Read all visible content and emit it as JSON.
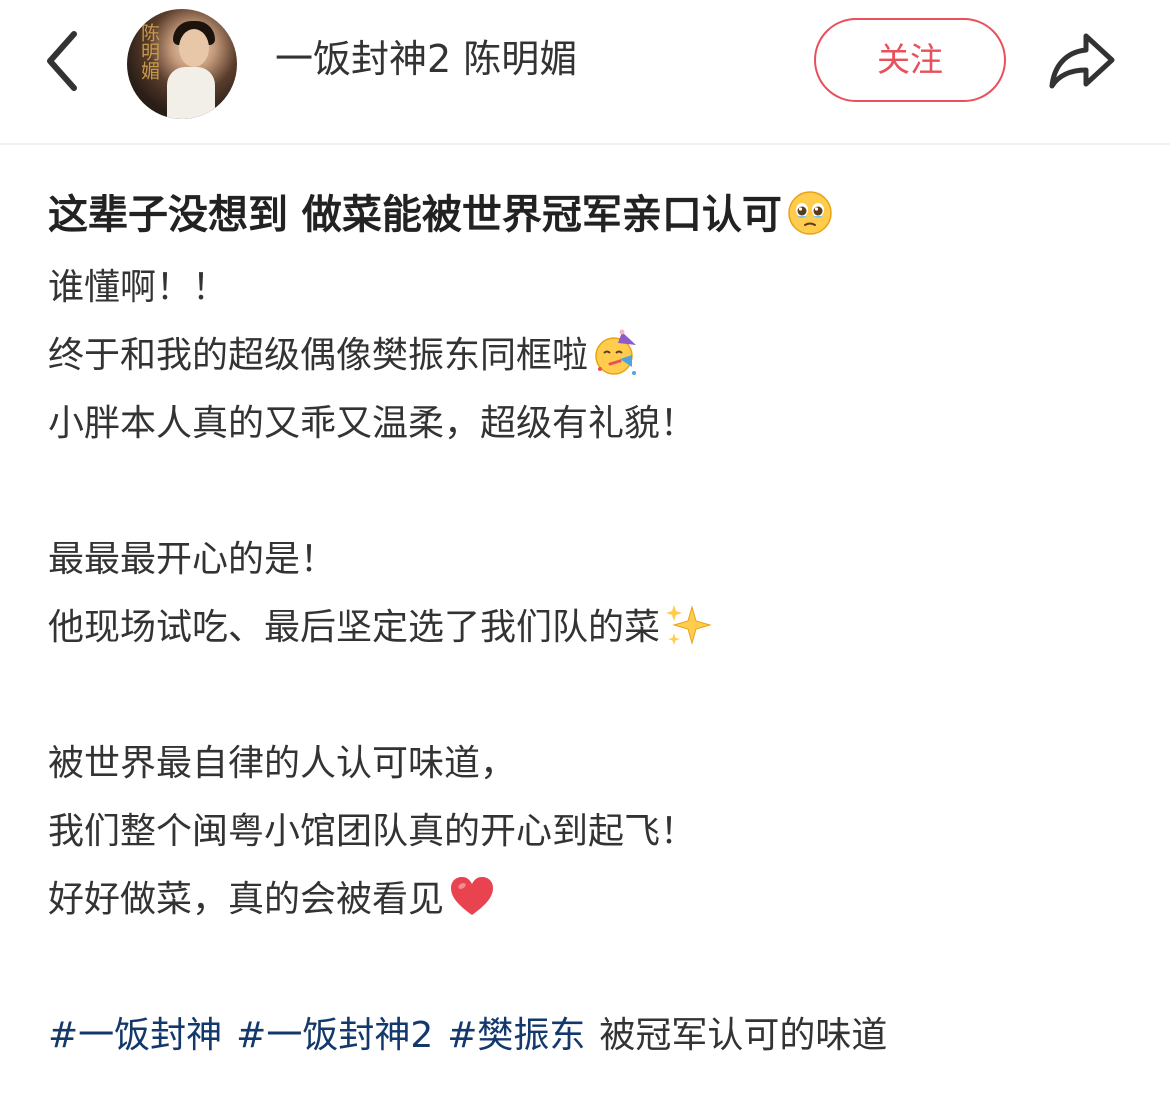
{
  "header": {
    "back_icon": "chevron-left-icon",
    "avatar_text": "陈明媚",
    "username": "一饭封神2 陈明媚",
    "follow_label": "关注",
    "share_icon": "share-arrow-icon",
    "accent_color": "#e8505b"
  },
  "post": {
    "title": "这辈子没想到 做菜能被世界冠军亲口认可",
    "title_emoji": "teary-face-icon",
    "lines": [
      {
        "text": "谁懂啊！！",
        "emoji": null
      },
      {
        "text": "终于和我的超级偶像樊振东同框啦",
        "emoji": "party-face-icon"
      },
      {
        "text": "小胖本人真的又乖又温柔，超级有礼貌！",
        "emoji": null
      },
      {
        "text": "",
        "emoji": null
      },
      {
        "text": "最最最开心的是！",
        "emoji": null
      },
      {
        "text": "他现场试吃、最后坚定选了我们队的菜",
        "emoji": "sparkles-icon"
      },
      {
        "text": "",
        "emoji": null
      },
      {
        "text": "被世界最自律的人认可味道，",
        "emoji": null
      },
      {
        "text": "我们整个闽粤小馆团队真的开心到起飞！",
        "emoji": null
      },
      {
        "text": "好好做菜，真的会被看见",
        "emoji": "red-heart-icon"
      }
    ],
    "hashtags": [
      "#一饭封神",
      "#一饭封神2",
      "#樊振东"
    ],
    "tag_suffix": "被冠军认可的味道",
    "hashtag_color": "#13386c"
  }
}
